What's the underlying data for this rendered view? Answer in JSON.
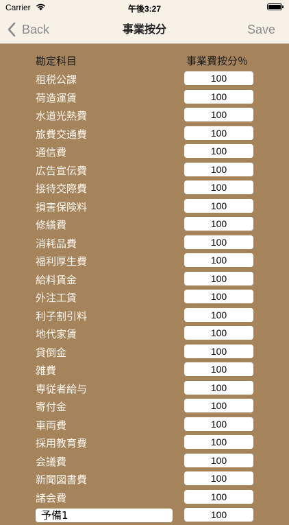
{
  "status_bar": {
    "carrier": "Carrier",
    "time": "午後3:27"
  },
  "nav": {
    "back_label": "Back",
    "title": "事業按分",
    "save_label": "Save"
  },
  "table": {
    "header_left": "勘定科目",
    "header_right": "事業費按分％",
    "rows": [
      {
        "label": "租税公課",
        "value": "100"
      },
      {
        "label": "荷造運賃",
        "value": "100"
      },
      {
        "label": "水道光熱費",
        "value": "100"
      },
      {
        "label": "旅費交通費",
        "value": "100"
      },
      {
        "label": "通信費",
        "value": "100"
      },
      {
        "label": "広告宣伝費",
        "value": "100"
      },
      {
        "label": "接待交際費",
        "value": "100"
      },
      {
        "label": "損害保険料",
        "value": "100"
      },
      {
        "label": "修繕費",
        "value": "100"
      },
      {
        "label": "消耗品費",
        "value": "100"
      },
      {
        "label": "福利厚生費",
        "value": "100"
      },
      {
        "label": "給料賃金",
        "value": "100"
      },
      {
        "label": "外注工賃",
        "value": "100"
      },
      {
        "label": "利子割引料",
        "value": "100"
      },
      {
        "label": "地代家賃",
        "value": "100"
      },
      {
        "label": "貸倒金",
        "value": "100"
      },
      {
        "label": "雑費",
        "value": "100"
      },
      {
        "label": "専従者給与",
        "value": "100"
      },
      {
        "label": "寄付金",
        "value": "100"
      },
      {
        "label": "車両費",
        "value": "100"
      },
      {
        "label": "採用教育費",
        "value": "100"
      },
      {
        "label": "会議費",
        "value": "100"
      },
      {
        "label": "新聞図書費",
        "value": "100"
      },
      {
        "label": "諸会費",
        "value": "100"
      },
      {
        "label": "予備1",
        "value": "100"
      }
    ]
  }
}
